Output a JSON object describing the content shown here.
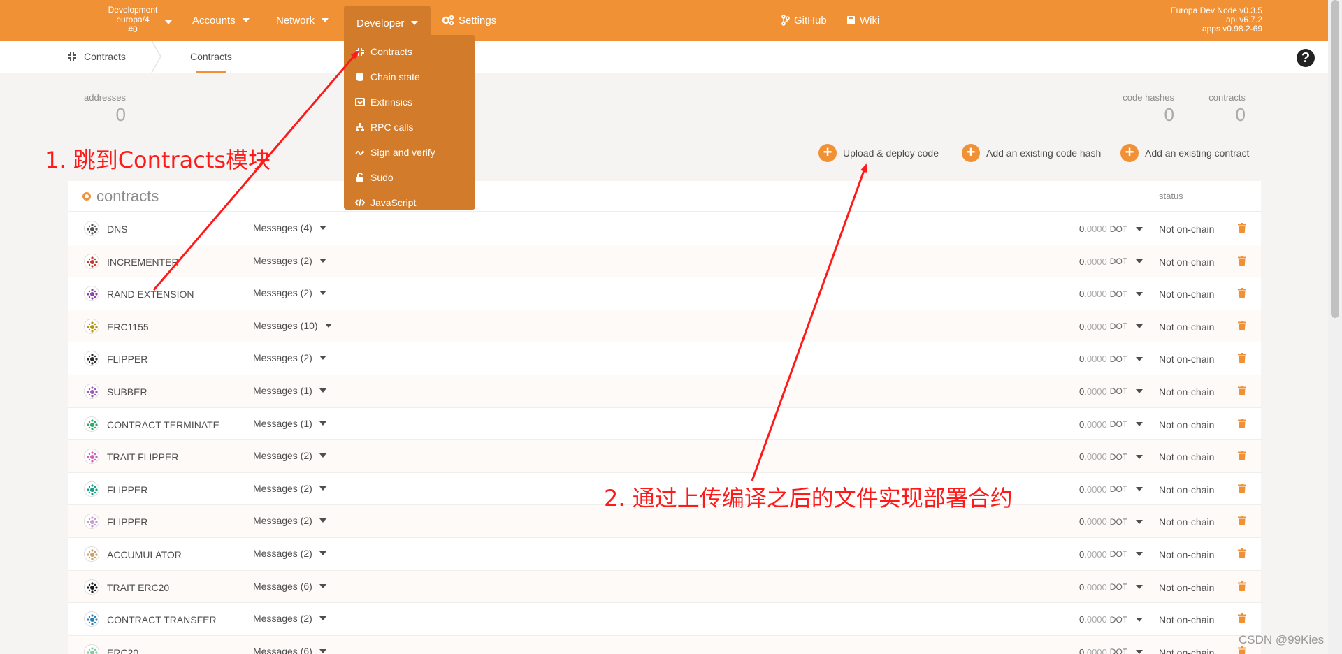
{
  "topbar": {
    "chain": {
      "line1": "Development",
      "line2": "europa/4",
      "line3": "#0"
    },
    "nav": {
      "accounts": "Accounts",
      "network": "Network",
      "developer": "Developer",
      "settings": "Settings",
      "github": "GitHub",
      "wiki": "Wiki"
    },
    "node_info": {
      "line1": "Europa Dev Node v0.3.5",
      "line2": "api v6.7.2",
      "line3": "apps v0.98.2-69"
    }
  },
  "subbar": {
    "root": "Contracts",
    "tab": "Contracts",
    "help": "?"
  },
  "developer_menu": [
    "Contracts",
    "Chain state",
    "Extrinsics",
    "RPC calls",
    "Sign and verify",
    "Sudo",
    "JavaScript"
  ],
  "stats": {
    "addresses": {
      "label": "addresses",
      "value": "0"
    },
    "code_hashes": {
      "label": "code hashes",
      "value": "0"
    },
    "contracts": {
      "label": "contracts",
      "value": "0"
    }
  },
  "actions": {
    "upload": "Upload & deploy code",
    "add_hash": "Add an existing code hash",
    "add_contract": "Add an existing contract"
  },
  "table": {
    "title": "contracts",
    "status_header": "status",
    "rows": [
      {
        "name": "DNS",
        "messages": "Messages (4)",
        "balance_int": "0",
        "balance_dec": ".0000",
        "unit": "DOT",
        "status": "Not on-chain",
        "color": "#555555"
      },
      {
        "name": "INCREMENTER",
        "messages": "Messages (2)",
        "balance_int": "0",
        "balance_dec": ".0000",
        "unit": "DOT",
        "status": "Not on-chain",
        "color": "#c0392b"
      },
      {
        "name": "RAND EXTENSION",
        "messages": "Messages (2)",
        "balance_int": "0",
        "balance_dec": ".0000",
        "unit": "DOT",
        "status": "Not on-chain",
        "color": "#8e44ad"
      },
      {
        "name": "ERC1155",
        "messages": "Messages (10)",
        "balance_int": "0",
        "balance_dec": ".0000",
        "unit": "DOT",
        "status": "Not on-chain",
        "color": "#b7950b"
      },
      {
        "name": "FLIPPER",
        "messages": "Messages (2)",
        "balance_int": "0",
        "balance_dec": ".0000",
        "unit": "DOT",
        "status": "Not on-chain",
        "color": "#2c2c2c"
      },
      {
        "name": "SUBBER",
        "messages": "Messages (1)",
        "balance_int": "0",
        "balance_dec": ".0000",
        "unit": "DOT",
        "status": "Not on-chain",
        "color": "#9b59b6"
      },
      {
        "name": "CONTRACT TERMINATE",
        "messages": "Messages (1)",
        "balance_int": "0",
        "balance_dec": ".0000",
        "unit": "DOT",
        "status": "Not on-chain",
        "color": "#27ae60"
      },
      {
        "name": "TRAIT FLIPPER",
        "messages": "Messages (2)",
        "balance_int": "0",
        "balance_dec": ".0000",
        "unit": "DOT",
        "status": "Not on-chain",
        "color": "#d35fb7"
      },
      {
        "name": "FLIPPER",
        "messages": "Messages (2)",
        "balance_int": "0",
        "balance_dec": ".0000",
        "unit": "DOT",
        "status": "Not on-chain",
        "color": "#16a085"
      },
      {
        "name": "FLIPPER",
        "messages": "Messages (2)",
        "balance_int": "0",
        "balance_dec": ".0000",
        "unit": "DOT",
        "status": "Not on-chain",
        "color": "#c39bd3"
      },
      {
        "name": "ACCUMULATOR",
        "messages": "Messages (2)",
        "balance_int": "0",
        "balance_dec": ".0000",
        "unit": "DOT",
        "status": "Not on-chain",
        "color": "#c8a165"
      },
      {
        "name": "TRAIT ERC20",
        "messages": "Messages (6)",
        "balance_int": "0",
        "balance_dec": ".0000",
        "unit": "DOT",
        "status": "Not on-chain",
        "color": "#1a1a1a"
      },
      {
        "name": "CONTRACT TRANSFER",
        "messages": "Messages (2)",
        "balance_int": "0",
        "balance_dec": ".0000",
        "unit": "DOT",
        "status": "Not on-chain",
        "color": "#2980b9"
      },
      {
        "name": "ERC20",
        "messages": "Messages (6)",
        "balance_int": "0",
        "balance_dec": ".0000",
        "unit": "DOT",
        "status": "Not on-chain",
        "color": "#7dcea0"
      }
    ]
  },
  "annotations": {
    "step1": "1. 跳到Contracts模块",
    "step2": "2. 通过上传编译之后的文件实现部署合约"
  },
  "watermark": "CSDN @99Kies",
  "colors": {
    "accent": "#f19135",
    "menu": "#d17b2b",
    "annotation": "#ff1a1a"
  }
}
